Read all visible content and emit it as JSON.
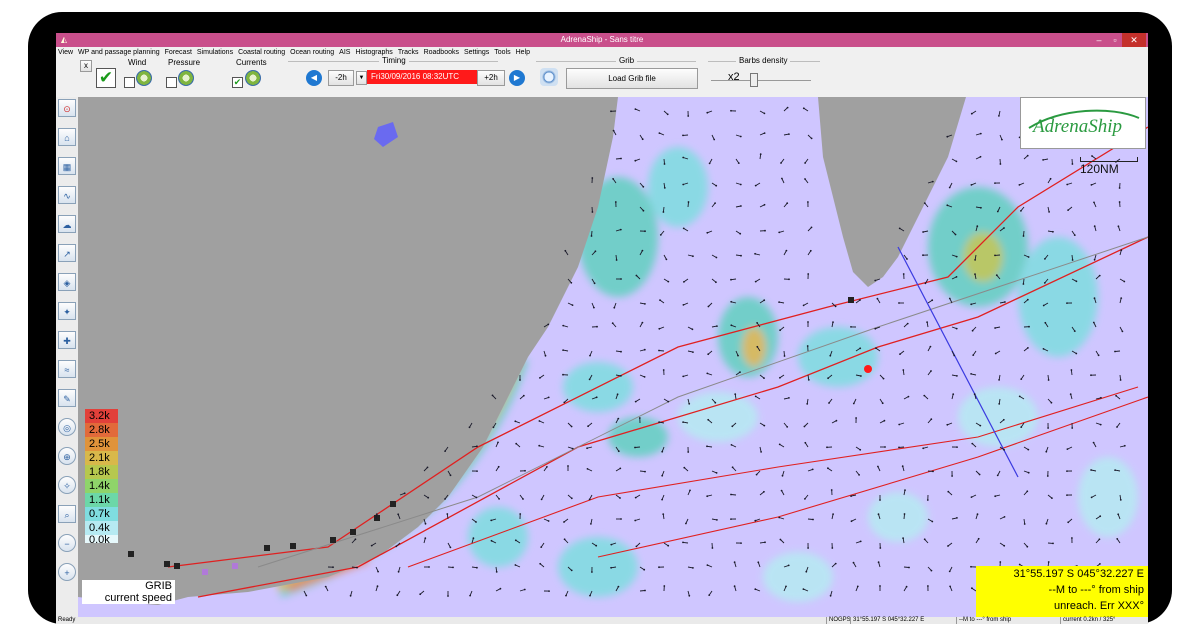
{
  "window": {
    "title": "AdrenaShip - Sans titre"
  },
  "menu": [
    "View",
    "WP and passage planning",
    "Forecast",
    "Simulations",
    "Coastal routing",
    "Ocean routing",
    "AIS",
    "Histographs",
    "Tracks",
    "Roadbooks",
    "Settings",
    "Tools",
    "Help"
  ],
  "toolbar": {
    "close_label": "x",
    "wind_label": "Wind",
    "pressure_label": "Pressure",
    "currents_label": "Currents",
    "timing_label": "Timing",
    "minus_label": "-2h",
    "date_value": "Fri30/09/2016 08:32UTC",
    "plus_label": "+2h",
    "grib_label": "Grib",
    "load_grib_label": "Load Grib file",
    "barbs_label": "Barbs density",
    "barbs_value": "x2"
  },
  "legend": {
    "values": [
      "3.2k",
      "2.8k",
      "2.5k",
      "2.1k",
      "1.8k",
      "1.4k",
      "1.1k",
      "0.7k",
      "0.4k",
      "0.0k"
    ],
    "colors": [
      "#e2403a",
      "#e26a3a",
      "#e0933a",
      "#d8b84a",
      "#b6c84e",
      "#8fd46a",
      "#6cd7a8",
      "#7fdde0",
      "#b6eaf2",
      "#e6f8fb"
    ],
    "caption_line1": "GRIB",
    "caption_line2": "current speed"
  },
  "logo": {
    "text": "AdrenaShip"
  },
  "scale": {
    "label": "120NM"
  },
  "coords": {
    "line1": "31°55.197 S  045°32.227 E",
    "line2": "--M to ---° from ship",
    "line3": "unreach. Err XXX°"
  },
  "status": {
    "ready": "Ready",
    "gps": "NOGPS",
    "position": "31°55.197 S  045°32.227 E",
    "from_ship": "--M to ---° from ship",
    "current": "current 0.2kn / 325°"
  },
  "colors": {
    "sea": "#cfc6ff",
    "land": "#a0a0a0",
    "route": "#e02020",
    "title_bar": "#c94f8b"
  }
}
